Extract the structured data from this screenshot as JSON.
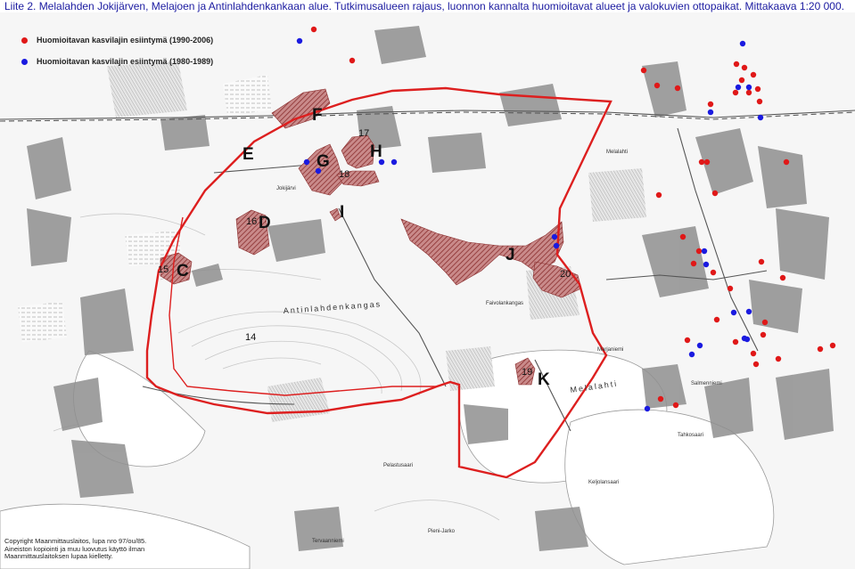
{
  "caption": "Liite 2. Melalahden Jokijärven, Melajoen ja Antinlahdenkankaan alue. Tutkimusalueen rajaus, luonnon kannalta huomioitavat alueet ja valokuvien ottopaikat. Mittakaava 1:20 000.",
  "legend": {
    "red": {
      "label": "Huomioitavan kasvilajin esiintymä (1990-2006)",
      "color": "#e01818"
    },
    "blue": {
      "label": "Huomioitavan kasvilajin esiintymä (1980-1989)",
      "color": "#1a1ae0"
    }
  },
  "area_letters": {
    "C": "C",
    "D": "D",
    "E": "E",
    "F": "F",
    "G": "G",
    "H": "H",
    "I": "I",
    "J": "J",
    "K": "K"
  },
  "photo_points": {
    "p14": "14",
    "p15": "15",
    "p16": "16",
    "p17": "17",
    "p18": "18",
    "p19": "19",
    "p20": "20"
  },
  "place_names": {
    "antinlahdenkangas": "Antinlahdenkangas",
    "melalahti_bay": "Melalahti",
    "melalahti_village": "Melalahti",
    "jokijarvi": "Jokijärvi",
    "fajvolankangas": "Faivolankangas",
    "salmenniemi": "Salmenniemi",
    "pieni_jarko": "Pieni-Jarko",
    "tervaanniemi": "Tervaanniemi",
    "keljolansaari": "Keljolansaari",
    "tahkosaari": "Tahkosaari",
    "pelastus": "Pelastusaari",
    "marjaniemi": "Marjaniemi"
  },
  "copyright": {
    "line1": "Copyright Maanmittauslaitos, lupa nro 97/ou/85.",
    "line2": "Aineiston kopiointi ja muu luovutus käyttö ilman",
    "line3": "Maanmittauslaitoksen lupaa kielletty."
  },
  "colors": {
    "boundary": "#dd1f1f",
    "hatch": "#b04a4a",
    "forest_gray": "#8c8c8c",
    "water": "#ffffff"
  }
}
